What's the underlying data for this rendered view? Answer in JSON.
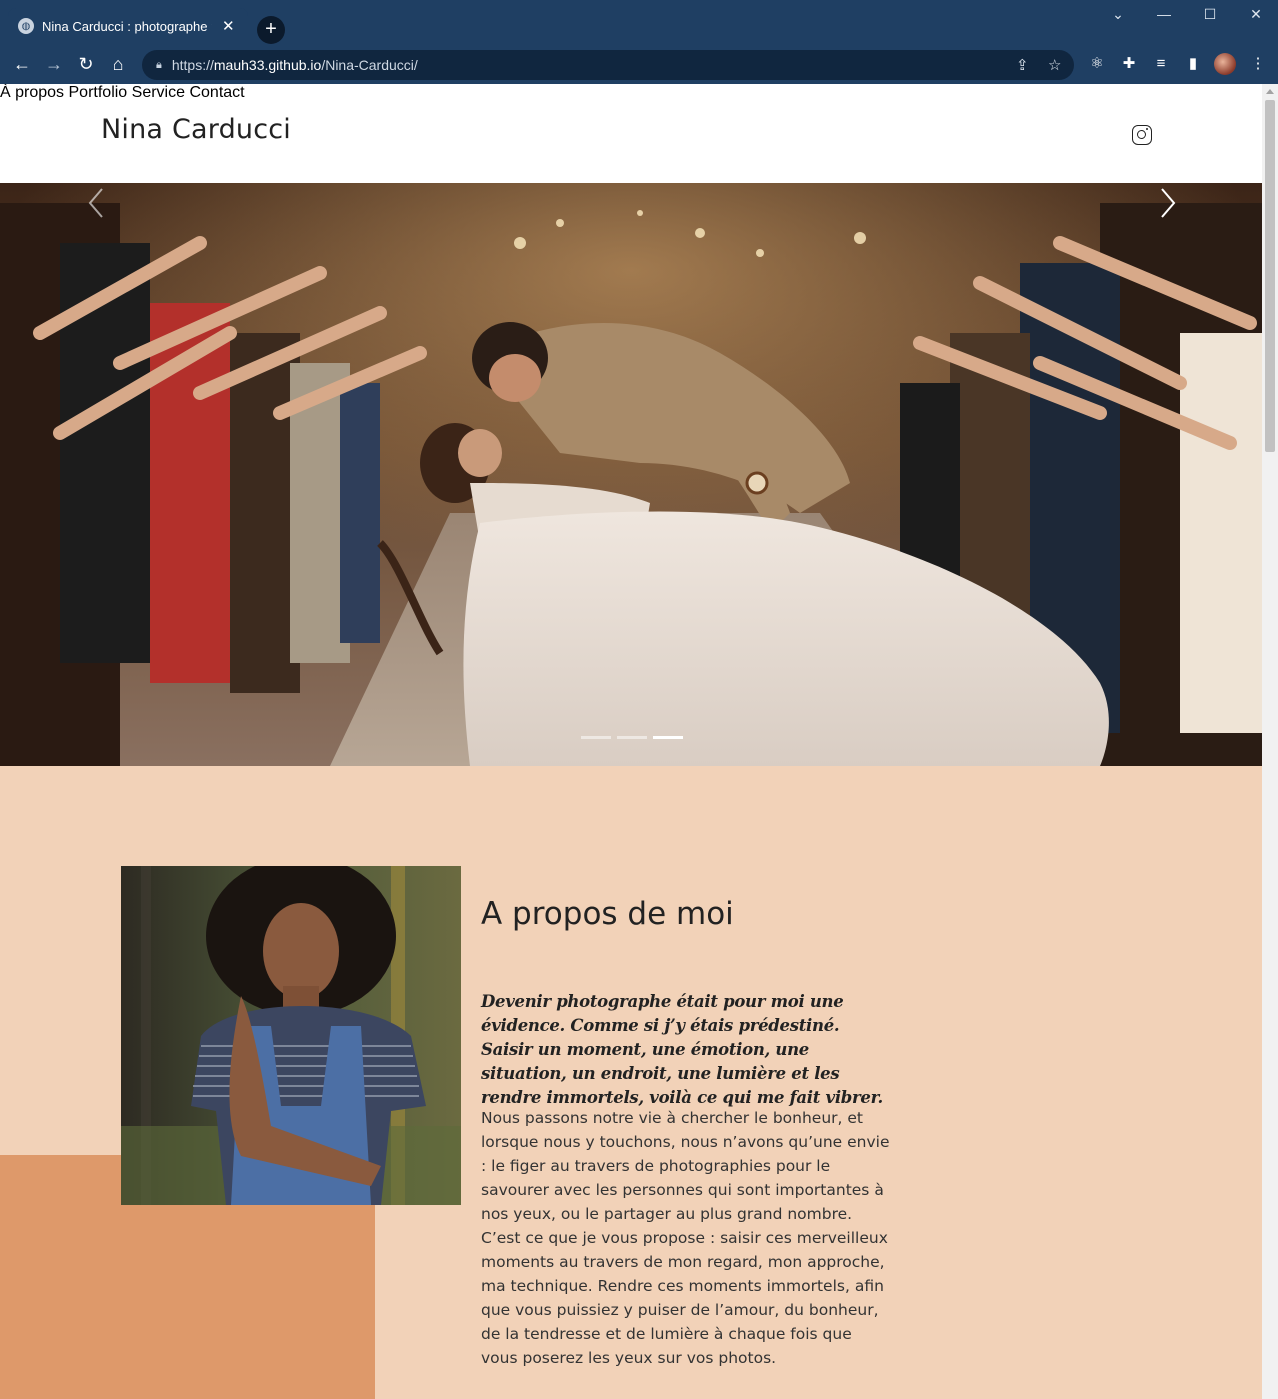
{
  "browser": {
    "tab_title": "Nina Carducci : photographe pas",
    "url_prefix": "https://",
    "url_domain": "mauh33.github.io",
    "url_path": "/Nina-Carducci/"
  },
  "site": {
    "logo": "Nina Carducci",
    "nav": [
      {
        "label": "À propos"
      },
      {
        "label": "Portfolio"
      },
      {
        "label": "Service"
      },
      {
        "label": "Contact"
      }
    ]
  },
  "carousel": {
    "slide_count": 3,
    "active_index": 2
  },
  "about": {
    "title": "A propos de moi",
    "quote": "Devenir photographe était pour moi une évidence. Comme si j’y étais prédestiné. Saisir un moment, une émotion, une situation, un endroit, une lumière et les rendre immortels, voilà ce qui me fait vibrer.",
    "body": "Nous passons notre vie à chercher le bonheur, et lorsque nous y touchons, nous n’avons qu’une envie : le figer au travers de photographies pour le savourer avec les personnes qui sont importantes à nos yeux, ou le partager au plus grand nombre. C’est ce que je vous propose : saisir ces merveilleux moments au travers de mon regard, mon approche, ma technique. Rendre ces moments immortels, afin que vous puissiez y puiser de l’amour, du bonheur, de la tendresse et de lumière à chaque fois que vous poserez les yeux sur vos photos."
  },
  "colors": {
    "chrome": "#1f3f63",
    "about_bg": "#f2d2b8",
    "about_accent": "#de996a"
  }
}
